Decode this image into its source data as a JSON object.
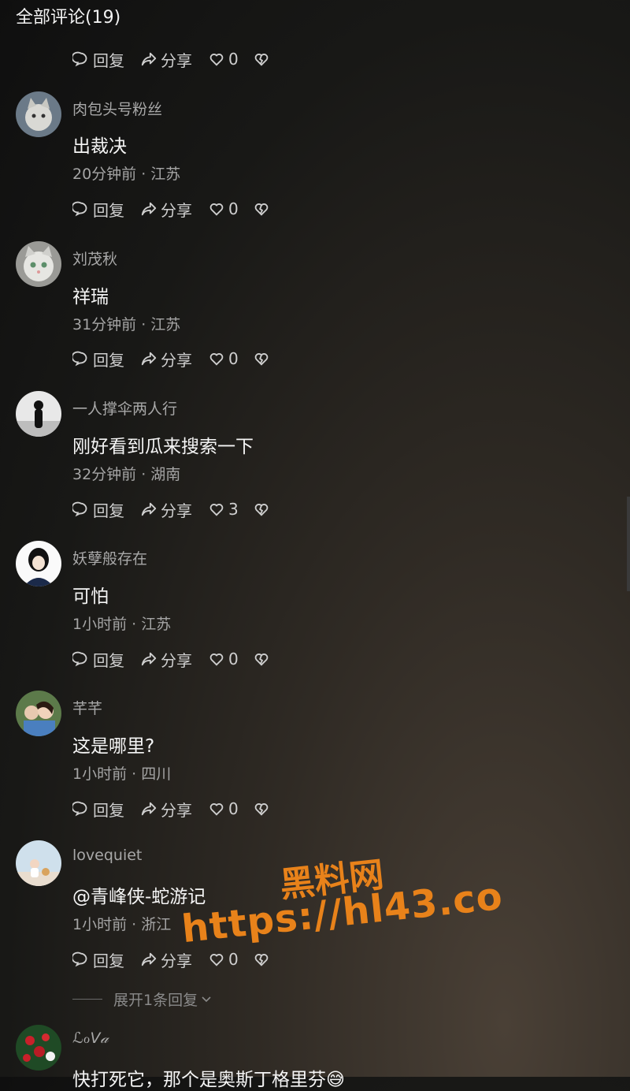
{
  "header": {
    "title": "全部评论(19)"
  },
  "action_labels": {
    "reply": "回复",
    "share": "分享"
  },
  "top_actions": {
    "likes": "0"
  },
  "comments": [
    {
      "name": "肉包头号粉丝",
      "text": "出裁决",
      "meta": "20分钟前 · 江苏",
      "likes": "0",
      "avatar": "cat-avatar"
    },
    {
      "name": "刘茂秋",
      "text": "祥瑞",
      "meta": "31分钟前 · 江苏",
      "likes": "0",
      "avatar": "cat-avatar"
    },
    {
      "name": "一人撑伞两人行",
      "text": "刚好看到瓜来搜索一下",
      "meta": "32分钟前 · 湖南",
      "likes": "3",
      "avatar": "silhouette-avatar"
    },
    {
      "name": "妖孽般存在",
      "text": "可怕",
      "meta": "1小时前 · 江苏",
      "likes": "0",
      "avatar": "cartoon-avatar"
    },
    {
      "name": "芊芊",
      "text": "这是哪里?",
      "meta": "1小时前 · 四川",
      "likes": "0",
      "avatar": "photo-avatar"
    },
    {
      "name": "lovequiet",
      "text": "@青峰侠-蛇游记",
      "meta": "1小时前 · 浙江",
      "likes": "0",
      "avatar": "child-avatar"
    },
    {
      "name": "ℒℴV𝒶",
      "text": "快打死它，那个是奥斯丁格里芬😅",
      "meta": "",
      "likes": "",
      "avatar": "flower-avatar"
    }
  ],
  "expand_replies": "展开1条回复",
  "watermark": {
    "line1": "黑料网",
    "line2": "https://hl43.co"
  },
  "colors": {
    "accent_watermark": "#e8821a",
    "text_primary": "#f5f5f5",
    "text_secondary": "#a5a5a5"
  }
}
